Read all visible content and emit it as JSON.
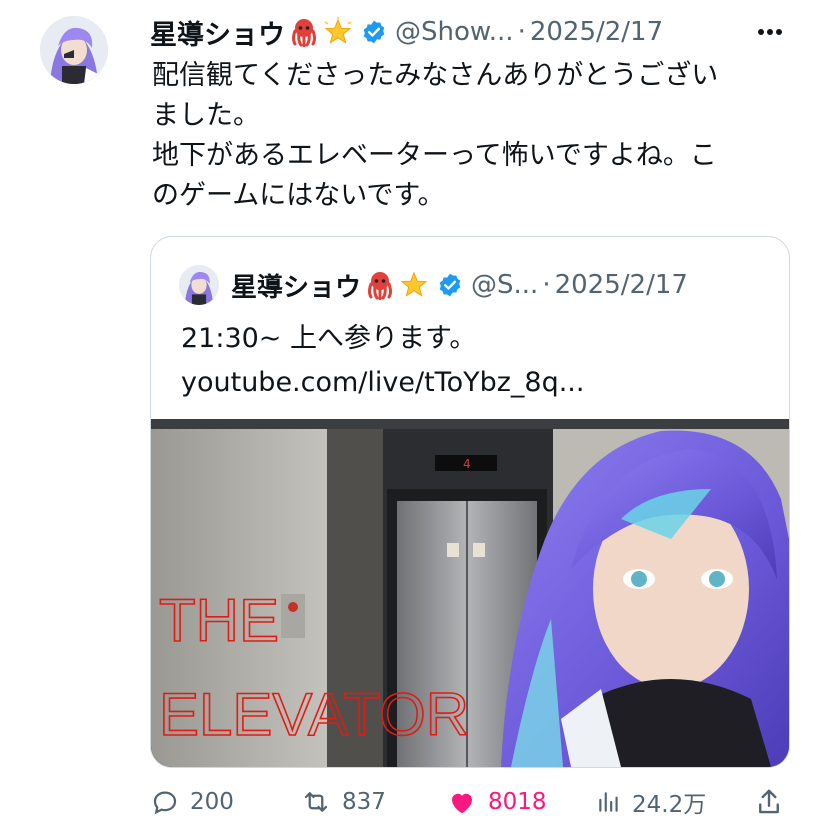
{
  "post": {
    "author_name": "星導ショウ",
    "author_emoji_1": "octopus-emoji",
    "author_emoji_2": "glowing-star-emoji",
    "handle": "@Show...",
    "dot": "·",
    "date": "2025/2/17",
    "text_lines": [
      "配信観てくださったみなさんありがとうござい",
      "ました。",
      "地下があるエレベーターって怖いですよね。こ",
      "のゲームにはないです。"
    ]
  },
  "quote": {
    "author_name": "星導ショウ",
    "handle": "@S...",
    "dot": "·",
    "date": "2025/2/17",
    "text_lines": [
      "21:30~ 上へ参ります。",
      "youtube.com/live/tToYbz_8q..."
    ],
    "image_title": "THE ELEVATOR",
    "image_title_lines": [
      "THE",
      "ELEVATOR"
    ]
  },
  "actions": {
    "replies": "200",
    "reposts": "837",
    "likes": "8018",
    "views": "24.2万"
  },
  "colors": {
    "accent_like": "#f91880",
    "secondary_text": "#536471",
    "verified": "#1d9bf0",
    "title_red": "#e11b14"
  }
}
